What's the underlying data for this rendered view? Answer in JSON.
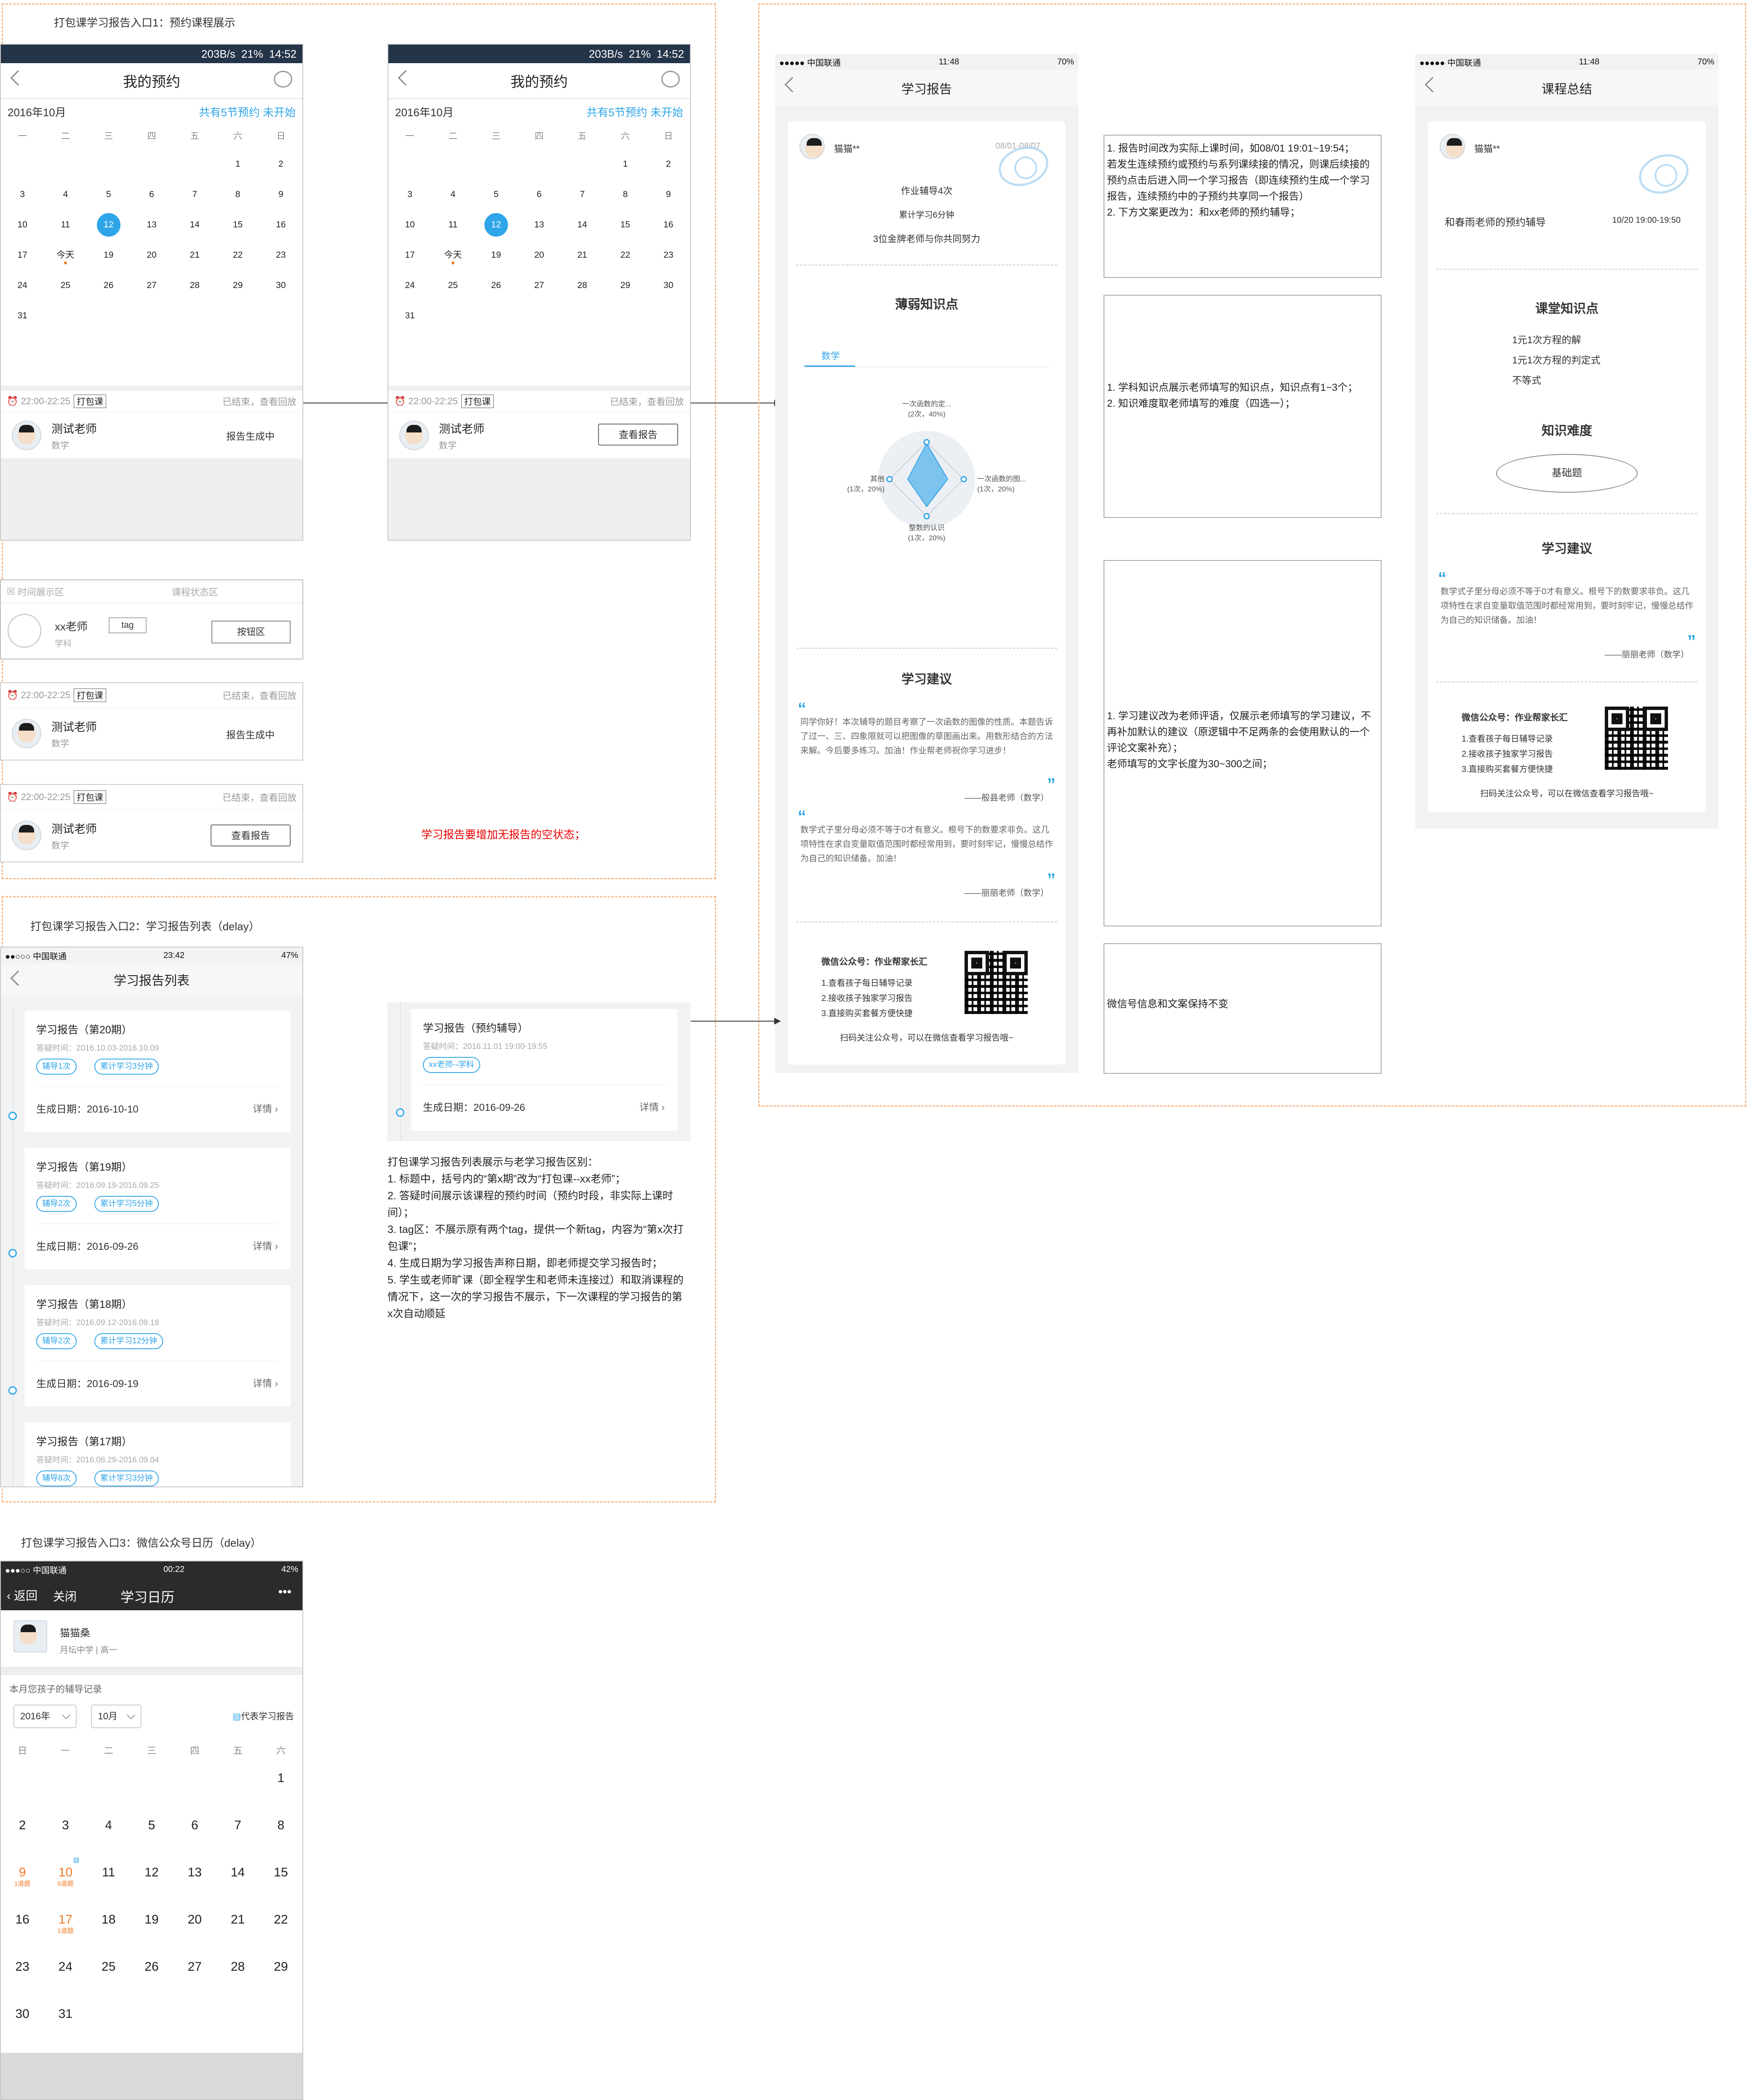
{
  "section1": {
    "title": "打包课学习报告入口1：预约课程展示",
    "phone_a": {
      "status": {
        "speed": "203B/s",
        "battery": "21%",
        "time": "14:52"
      },
      "nav_title": "我的预约",
      "month": "2016年10月",
      "more": "共有5节预约 未开始",
      "weekdays": [
        "一",
        "二",
        "三",
        "四",
        "五",
        "六",
        "日"
      ],
      "days": [
        "",
        "",
        "",
        "",
        "",
        "1",
        "2",
        "3",
        "4",
        "5",
        "6",
        "7",
        "8",
        "9",
        "10",
        "11",
        "12",
        "13",
        "14",
        "15",
        "16",
        "17",
        "今天",
        "19",
        "20",
        "21",
        "22",
        "23",
        "24",
        "25",
        "26",
        "27",
        "28",
        "29",
        "30",
        "31",
        "",
        "",
        "",
        "",
        "",
        ""
      ],
      "card": {
        "time": "22:00-22:25",
        "tag": "打包课",
        "status": "已结束，查看回放",
        "teacher": "测试老师",
        "subject": "数学",
        "right_text": "报告生成中"
      }
    },
    "phone_b": {
      "status": {
        "speed": "203B/s",
        "battery": "21%",
        "time": "14:52"
      },
      "nav_title": "我的预约",
      "month": "2016年10月",
      "more": "共有5节预约 未开始",
      "card": {
        "time": "22:00-22:25",
        "tag": "打包课",
        "status": "已结束，查看回放",
        "teacher": "测试老师",
        "subject": "数学",
        "button": "查看报告"
      }
    },
    "template": {
      "time_area": "时间展示区",
      "status_area": "课程状态区",
      "teacher": "xx老师",
      "tag": "tag",
      "subject": "学科",
      "button": "按钮区"
    },
    "card2": {
      "time": "22:00-22:25",
      "tag": "打包课",
      "status": "已结束，查看回放",
      "teacher": "测试老师",
      "subject": "数学",
      "right_text": "报告生成中"
    },
    "card3": {
      "time": "22:00-22:25",
      "tag": "打包课",
      "status": "已结束，查看回放",
      "teacher": "测试老师",
      "subject": "数学",
      "button": "查看报告"
    },
    "red_note": "学习报告要增加无报告的空状态；"
  },
  "report": {
    "status": {
      "carrier": "●●●●● 中国联通",
      "time": "11:48",
      "battery": "70%"
    },
    "nav_title": "学习报告",
    "user": "猫猫**",
    "date_range": "08/01-08/07",
    "stats": [
      "作业辅导4次",
      "累计学习6分钟",
      "3位金牌老师与你共同努力"
    ],
    "weak_title": "薄弱知识点",
    "subject_tab": "数学",
    "radar": {
      "top": "一次函数的定...",
      "top_sub": "(2次，40%)",
      "right": "一次函数的图...",
      "right_sub": "(1次，20%)",
      "bottom": "整数的认识",
      "bottom_sub": "(1次，20%)",
      "left": "其他",
      "left_sub": "(1次，20%)"
    },
    "advice_title": "学习建议",
    "advice1": "同学你好！本次辅导的题目考察了一次函数的图像的性质。本题告诉了过一、三、四象限就可以把图像的草图画出来。用数形结合的方法来解。今后要多练习。加油！作业帮老师祝你学习进步！",
    "advice1_sign": "——般县老师（数学）",
    "advice2": "数学式子里分母必须不等于0才有意义。根号下的数要求非负。这几项特性在求自变量取值范围时都经常用到，要时刻牢记，慢慢总结作为自己的知识储备。加油！",
    "advice2_sign": "——丽丽老师（数学）",
    "wechat_title": "微信公众号：作业帮家长汇",
    "wechat_items": [
      "1.查看孩子每日辅导记录",
      "2.接收孩子独家学习报告",
      "3.直接购买套餐方便快捷"
    ],
    "wechat_foot": "扫码关注公众号，可以在微信查看学习报告哦~"
  },
  "notes": {
    "n1": "1. 报告时间改为实际上课时间，如08/01 19:01~19:54；\n若发生连续预约或预约与系列课续接的情况，则课后续接的预约点击后进入同一个学习报告（即连续预约生成一个学习报告，连续预约中的子预约共享同一个报告）\n2. 下方文案更改为：和xx老师的预约辅导；",
    "n2": "1. 学科知识点展示老师填写的知识点，知识点有1~3个；\n2. 知识难度取老师填写的难度（四选一）；",
    "n3": "1. 学习建议改为老师评语，仅展示老师填写的学习建议，不再补加默认的建议（原逻辑中不足两条的会使用默认的一个评论文案补充）；\n老师填写的文字长度为30~300之间；",
    "n4": "微信号信息和文案保持不变"
  },
  "summary": {
    "status": {
      "carrier": "●●●●● 中国联通",
      "time": "11:48",
      "battery": "70%"
    },
    "nav_title": "课程总结",
    "user": "猫猫**",
    "lesson": "和春雨老师的预约辅导",
    "lesson_time": "10/20 19:00-19:50",
    "kp_title": "课堂知识点",
    "kp_items": [
      "1元1次方程的解",
      "1元1次方程的判定式",
      "不等式"
    ],
    "diff_title": "知识难度",
    "diff_value": "基础题",
    "advice_title": "学习建议",
    "advice": "数学式子里分母必须不等于0才有意义。根号下的数要求非负。这几项特性在求自变量取值范围时都经常用到，要时刻牢记，慢慢总结作为自己的知识储备。加油！",
    "advice_sign": "——丽丽老师（数学）",
    "wechat_title": "微信公众号：作业帮家长汇",
    "wechat_items": [
      "1.查看孩子每日辅导记录",
      "2.接收孩子独家学习报告",
      "3.直接购买套餐方便快捷"
    ],
    "wechat_foot": "扫码关注公众号，可以在微信查看学习报告哦~"
  },
  "section2": {
    "title": "打包课学习报告入口2：学习报告列表（delay）",
    "status": {
      "carrier": "●●○○○ 中国联通",
      "time": "23:42",
      "battery": "47%"
    },
    "nav_title": "学习报告列表",
    "items": [
      {
        "title": "学习报告（第20期）",
        "time": "答疑时间：2016.10.03-2016.10.09",
        "tag1": "辅导1次",
        "tag2": "累计学习3分钟",
        "date": "生成日期：2016-10-10",
        "more": "详情"
      },
      {
        "title": "学习报告（第19期）",
        "time": "答疑时间：2016.09.19-2016.09.25",
        "tag1": "辅导2次",
        "tag2": "累计学习5分钟",
        "date": "生成日期：2016-09-26",
        "more": "详情"
      },
      {
        "title": "学习报告（第18期）",
        "time": "答疑时间：2016.09.12-2016.09.18",
        "tag1": "辅导2次",
        "tag2": "累计学习12分钟",
        "date": "生成日期：2016-09-19",
        "more": "详情"
      },
      {
        "title": "学习报告（第17期）",
        "time": "答疑时间：2016.08.29-2016.09.04",
        "tag1": "辅导8次",
        "tag2": "累计学习3分钟",
        "date": "",
        "more": ""
      }
    ],
    "new_item": {
      "title": "学习报告（预约辅导）",
      "time": "答疑时间：2016.11.01 19:00-19:55",
      "tag": "xx老师--学科",
      "date": "生成日期：2016-09-26",
      "more": "详情"
    },
    "note": "打包课学习报告列表展示与老学习报告区别：\n1. 标题中，括号内的“第x期”改为“打包课--xx老师”；\n2. 答疑时间展示该课程的预约时间（预约时段，非实际上课时间）；\n3. tag区：不展示原有两个tag，提供一个新tag，内容为“第x次打包课”；\n4. 生成日期为学习报告声称日期，即老师提交学习报告时；\n5. 学生或老师旷课（即全程学生和老师未连接过）和取消课程的情况下，这一次的学习报告不展示，下一次课程的学习报告的第x次自动顺延"
  },
  "section3": {
    "title": "打包课学习报告入口3：微信公众号日历（delay）",
    "status": {
      "carrier": "●●●○○ 中国联通",
      "time": "00:22",
      "battery": "42%"
    },
    "back": "返回",
    "close": "关闭",
    "nav_title": "学习日历",
    "menu": "•••",
    "user": "猫猫桑",
    "school": "月坛中学 | 高一",
    "record_title": "本月您孩子的辅导记录",
    "year": "2016年",
    "month": "10月",
    "legend": "代表学习报告",
    "weekdays": [
      "日",
      "一",
      "二",
      "三",
      "四",
      "五",
      "六"
    ],
    "days": [
      {
        "d": ""
      },
      {
        "d": ""
      },
      {
        "d": ""
      },
      {
        "d": ""
      },
      {
        "d": ""
      },
      {
        "d": ""
      },
      {
        "d": "1"
      },
      {
        "d": "2"
      },
      {
        "d": "3"
      },
      {
        "d": "4"
      },
      {
        "d": "5"
      },
      {
        "d": "6"
      },
      {
        "d": "7"
      },
      {
        "d": "8"
      },
      {
        "d": "9",
        "sub": "1道题"
      },
      {
        "d": "10",
        "sub": "0道题"
      },
      {
        "d": "11"
      },
      {
        "d": "12"
      },
      {
        "d": "13"
      },
      {
        "d": "14"
      },
      {
        "d": "15"
      },
      {
        "d": "16"
      },
      {
        "d": "17",
        "sub": "1道题"
      },
      {
        "d": "18"
      },
      {
        "d": "19"
      },
      {
        "d": "20"
      },
      {
        "d": "21"
      },
      {
        "d": "22"
      },
      {
        "d": "23"
      },
      {
        "d": "24"
      },
      {
        "d": "25"
      },
      {
        "d": "26"
      },
      {
        "d": "27"
      },
      {
        "d": "28"
      },
      {
        "d": "29"
      },
      {
        "d": "30"
      },
      {
        "d": "31"
      },
      {
        "d": ""
      },
      {
        "d": ""
      },
      {
        "d": ""
      },
      {
        "d": ""
      },
      {
        "d": ""
      }
    ]
  },
  "colors": {
    "accent": "#2fa5e9",
    "dark_bar": "#243449",
    "orange": "#f07a27",
    "dash": "#f4b98a",
    "red": "#e00000"
  }
}
